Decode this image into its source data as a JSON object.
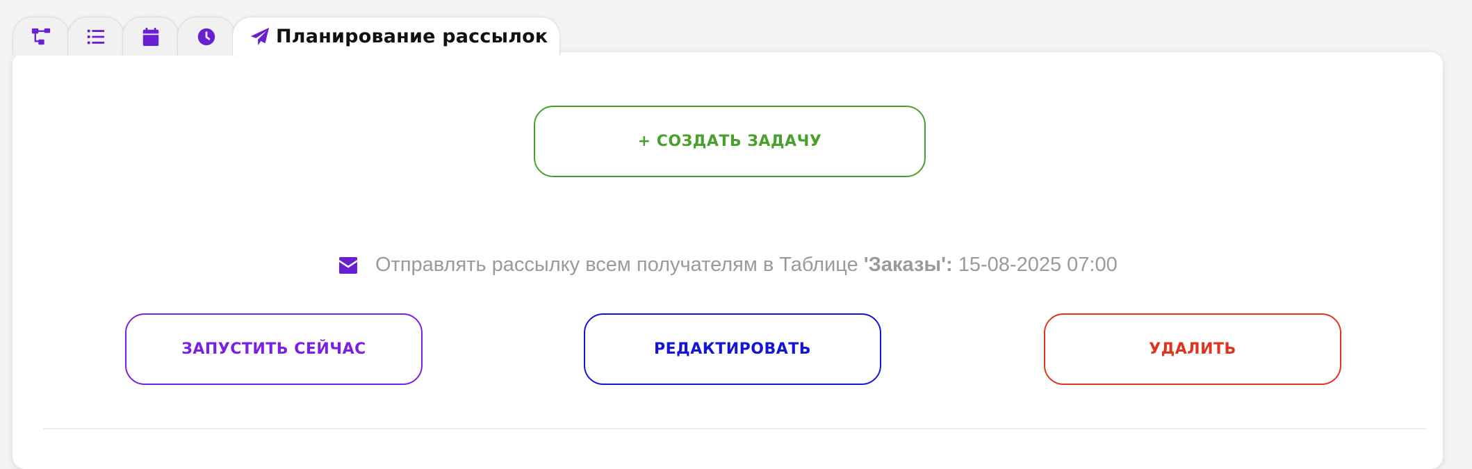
{
  "tabs": {
    "items": [
      {
        "icon": "sitemap-icon"
      },
      {
        "icon": "list-icon"
      },
      {
        "icon": "calendar-icon"
      },
      {
        "icon": "clock-icon"
      },
      {
        "icon": "paper-plane-icon",
        "label": "Планирование рассылок",
        "active": true
      }
    ]
  },
  "main": {
    "create_button": "+ Создать задачу",
    "schedule": {
      "icon": "envelope-icon",
      "prefix": "Отправлять рассылку всем получателям в Таблице ",
      "table_name": "'Заказы'",
      "separator": ": ",
      "datetime": "15-08-2025 07:00"
    },
    "actions": {
      "run_now": "Запустить сейчас",
      "edit": "Редактировать",
      "delete": "Удалить"
    }
  },
  "colors": {
    "accent": "#6a1fd1",
    "create": "#4aa02c",
    "run": "#7a1fe5",
    "edit": "#1414d6",
    "delete": "#e0341f"
  }
}
